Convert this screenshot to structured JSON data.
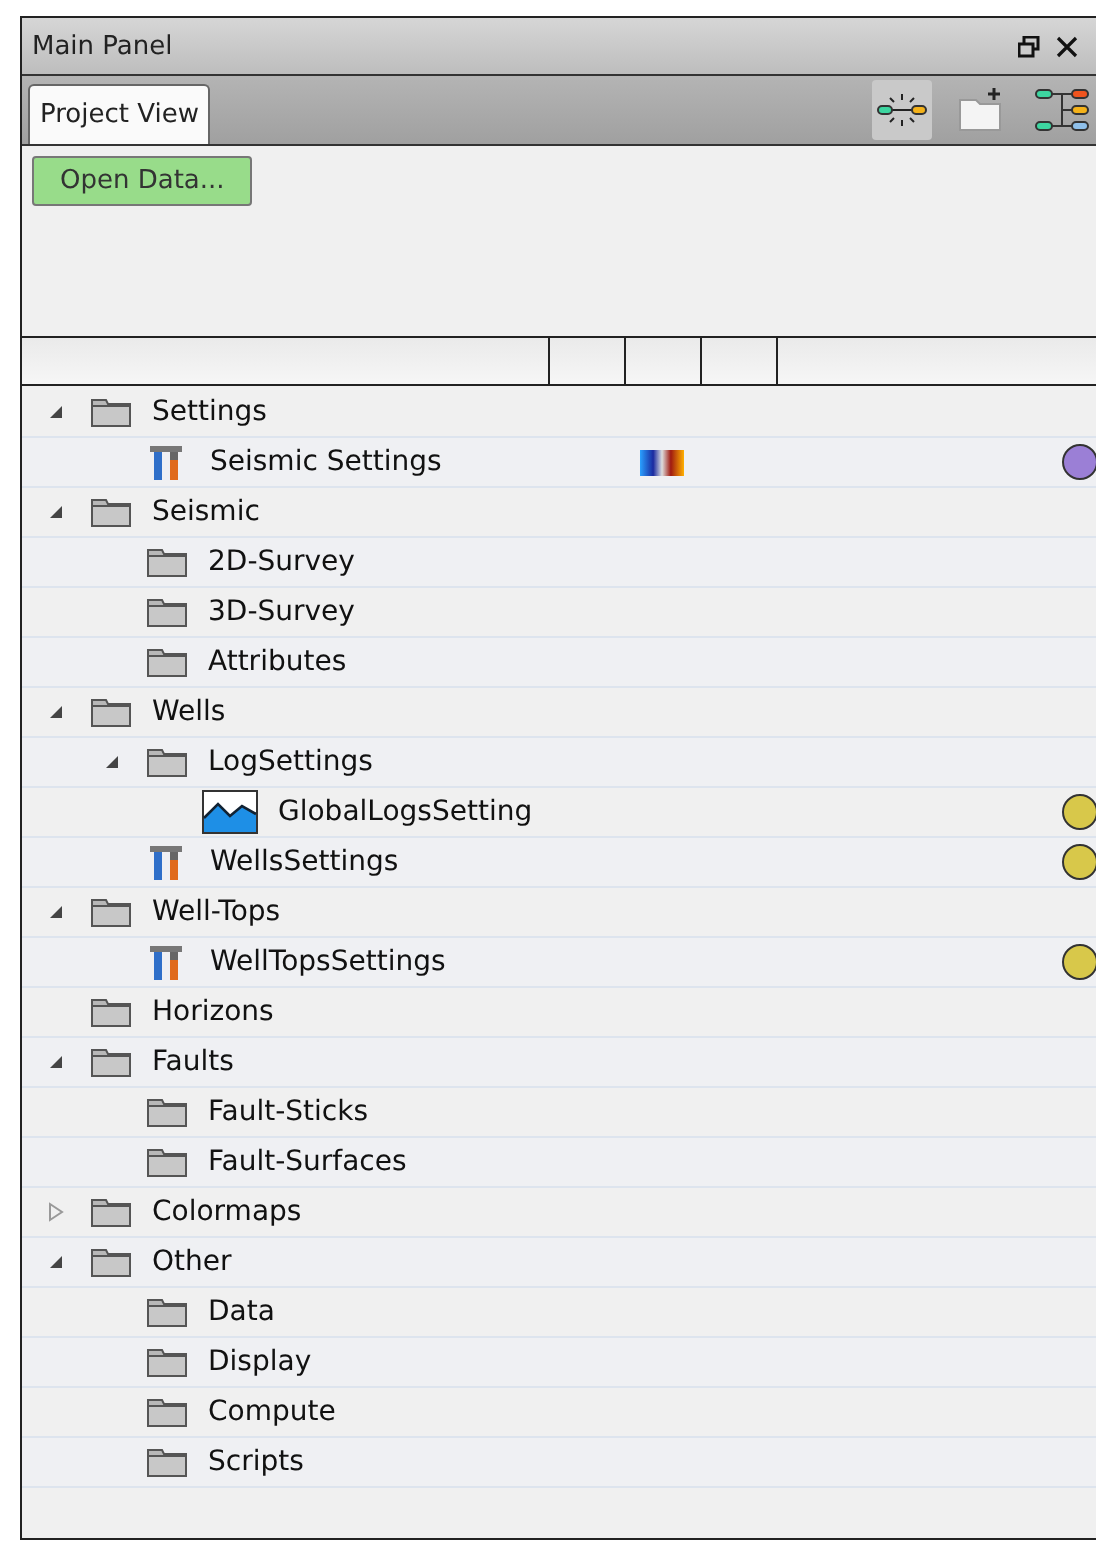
{
  "window": {
    "title": "Main Panel"
  },
  "tabs": [
    {
      "label": "Project View",
      "selected": true
    }
  ],
  "toolbar": [
    {
      "kind": "network",
      "pressed": true
    },
    {
      "kind": "new-folder",
      "pressed": false
    },
    {
      "kind": "tree",
      "pressed": false
    }
  ],
  "open_button": {
    "label": "Open Data..."
  },
  "tree": [
    {
      "label": "Settings",
      "kind": "folder",
      "expanded": true,
      "children": [
        {
          "label": "Seismic Settings",
          "kind": "tools",
          "has_colorbar": true,
          "color": "#9b7fd6"
        }
      ]
    },
    {
      "label": "Seismic",
      "kind": "folder",
      "expanded": true,
      "children": [
        {
          "label": "2D-Survey",
          "kind": "folder"
        },
        {
          "label": "3D-Survey",
          "kind": "folder"
        },
        {
          "label": "Attributes",
          "kind": "folder"
        }
      ]
    },
    {
      "label": "Wells",
      "kind": "folder",
      "expanded": true,
      "children": [
        {
          "label": "LogSettings",
          "kind": "folder",
          "expanded": true,
          "children": [
            {
              "label": "GlobalLogsSetting",
              "kind": "log",
              "color": "#d8c84a"
            }
          ]
        },
        {
          "label": "WellsSettings",
          "kind": "tools",
          "color": "#d8c84a"
        }
      ]
    },
    {
      "label": "Well-Tops",
      "kind": "folder",
      "expanded": true,
      "children": [
        {
          "label": "WellTopsSettings",
          "kind": "tools",
          "color": "#d8c84a"
        }
      ]
    },
    {
      "label": "Horizons",
      "kind": "folder"
    },
    {
      "label": "Faults",
      "kind": "folder",
      "expanded": true,
      "children": [
        {
          "label": "Fault-Sticks",
          "kind": "folder"
        },
        {
          "label": "Fault-Surfaces",
          "kind": "folder"
        }
      ]
    },
    {
      "label": "Colormaps",
      "kind": "folder",
      "expanded": false
    },
    {
      "label": "Other",
      "kind": "folder",
      "expanded": true,
      "children": [
        {
          "label": "Data",
          "kind": "folder"
        },
        {
          "label": "Display",
          "kind": "folder"
        },
        {
          "label": "Compute",
          "kind": "folder"
        },
        {
          "label": "Scripts",
          "kind": "folder"
        }
      ]
    }
  ]
}
